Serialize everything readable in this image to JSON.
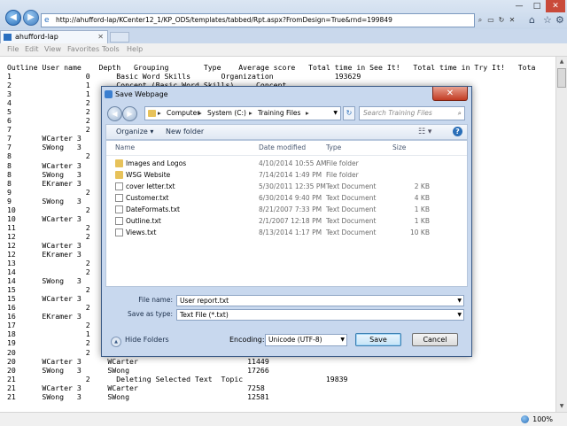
{
  "browser": {
    "address": "http://ahufford-lap/KCenter12_1/KP_ODS/templates/tabbed/Rpt.aspx?FromDesign=True&rnd=199849",
    "tab_label": "ahufford-lap",
    "menu": [
      "File",
      "Edit",
      "View",
      "Favorites",
      "Tools",
      "Help"
    ],
    "zoom": "100%"
  },
  "report": {
    "header": "Outline User name    Depth   Grouping        Type    Average score   Total time in See It!   Total time in Try It!   Tota",
    "lines": [
      "1                 0      Basic Word Skills       Organization              193629",
      "2                 1      Concept (Basic Word Skills)     Concept",
      "3                 1",
      "4                 2",
      "5                 2",
      "6                 2",
      "7                 2",
      "7       WCarter 3",
      "7       SWong   3",
      "8                 2",
      "8       WCarter 3",
      "8       SWong   3",
      "8       EKramer 3",
      "9                 2",
      "9       SWong   3",
      "10                2",
      "10      WCarter 3",
      "11                2",
      "12                2",
      "12      WCarter 3",
      "12      EKramer 3",
      "13                2",
      "14                2",
      "14      SWong   3",
      "15                2",
      "15      WCarter 3",
      "16                2",
      "16      EKramer 3",
      "17                2",
      "18                1",
      "19                2",
      "20                2",
      "20      WCarter 3      WCarter                         11449",
      "20      SWong   3      SWong                           17266",
      "21                2      Deleting Selected Text  Topic                   19839",
      "21      WCarter 3      WCarter                         7258",
      "21      SWong   3      SWong                           12581"
    ]
  },
  "dialog": {
    "title": "Save Webpage",
    "breadcrumb": [
      "Computer",
      "System (C:)",
      "Training Files"
    ],
    "search_placeholder": "Search Training Files",
    "organize_label": "Organize ▾",
    "new_folder_label": "New folder",
    "columns": {
      "name": "Name",
      "date": "Date modified",
      "type": "Type",
      "size": "Size"
    },
    "files": [
      {
        "name": "Images and Logos",
        "date": "4/10/2014 10:55 AM",
        "type": "File folder",
        "size": "",
        "kind": "folder"
      },
      {
        "name": "WSG Website",
        "date": "7/14/2014 1:49 PM",
        "type": "File folder",
        "size": "",
        "kind": "folder"
      },
      {
        "name": "cover letter.txt",
        "date": "5/30/2011 12:35 PM",
        "type": "Text Document",
        "size": "2 KB",
        "kind": "doc"
      },
      {
        "name": "Customer.txt",
        "date": "6/30/2014 9:40 PM",
        "type": "Text Document",
        "size": "4 KB",
        "kind": "doc"
      },
      {
        "name": "DateFormats.txt",
        "date": "8/21/2007 7:33 PM",
        "type": "Text Document",
        "size": "1 KB",
        "kind": "doc"
      },
      {
        "name": "Outline.txt",
        "date": "2/1/2007 12:18 PM",
        "type": "Text Document",
        "size": "1 KB",
        "kind": "doc"
      },
      {
        "name": "Views.txt",
        "date": "8/13/2014 1:17 PM",
        "type": "Text Document",
        "size": "10 KB",
        "kind": "doc"
      }
    ],
    "file_name_label": "File name:",
    "file_name_value": "User report.txt",
    "save_type_label": "Save as type:",
    "save_type_value": "Text File (*.txt)",
    "hide_folders_label": "Hide Folders",
    "encoding_label": "Encoding:",
    "encoding_value": "Unicode (UTF-8)",
    "save_label": "Save",
    "cancel_label": "Cancel"
  }
}
